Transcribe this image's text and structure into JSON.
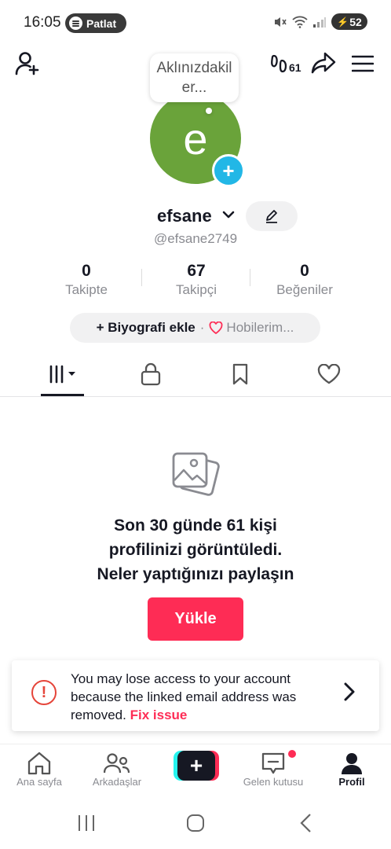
{
  "status": {
    "time": "16:05",
    "spotify_label": "Patlat",
    "battery": "52"
  },
  "header": {
    "views_count": "61"
  },
  "bubble": {
    "text": "Aklınızdakiler..."
  },
  "profile": {
    "avatar_letter": "e",
    "name": "efsane",
    "handle": "@efsane2749"
  },
  "stats": [
    {
      "value": "0",
      "label": "Takipte"
    },
    {
      "value": "67",
      "label": "Takipçi"
    },
    {
      "value": "0",
      "label": "Beğeniler"
    }
  ],
  "bio": {
    "add_label": "+ Biyografi ekle",
    "separator": "·",
    "hobby_label": "Hobilerim..."
  },
  "empty": {
    "line1": "Son 30 günde 61 kişi",
    "line2": "profilinizi görüntüledi.",
    "line3": "Neler yaptığınızı paylaşın",
    "upload_label": "Yükle"
  },
  "warning": {
    "text": "You may lose access to your account because the linked email address was removed.",
    "fix_label": "Fix issue"
  },
  "nav": [
    {
      "label": "Ana sayfa"
    },
    {
      "label": "Arkadaşlar"
    },
    {
      "label": "Gelen kutusu"
    },
    {
      "label": "Profil"
    }
  ],
  "colors": {
    "accent": "#fe2c55",
    "avatar": "#6aa33a",
    "add_badge": "#22b7e6"
  }
}
